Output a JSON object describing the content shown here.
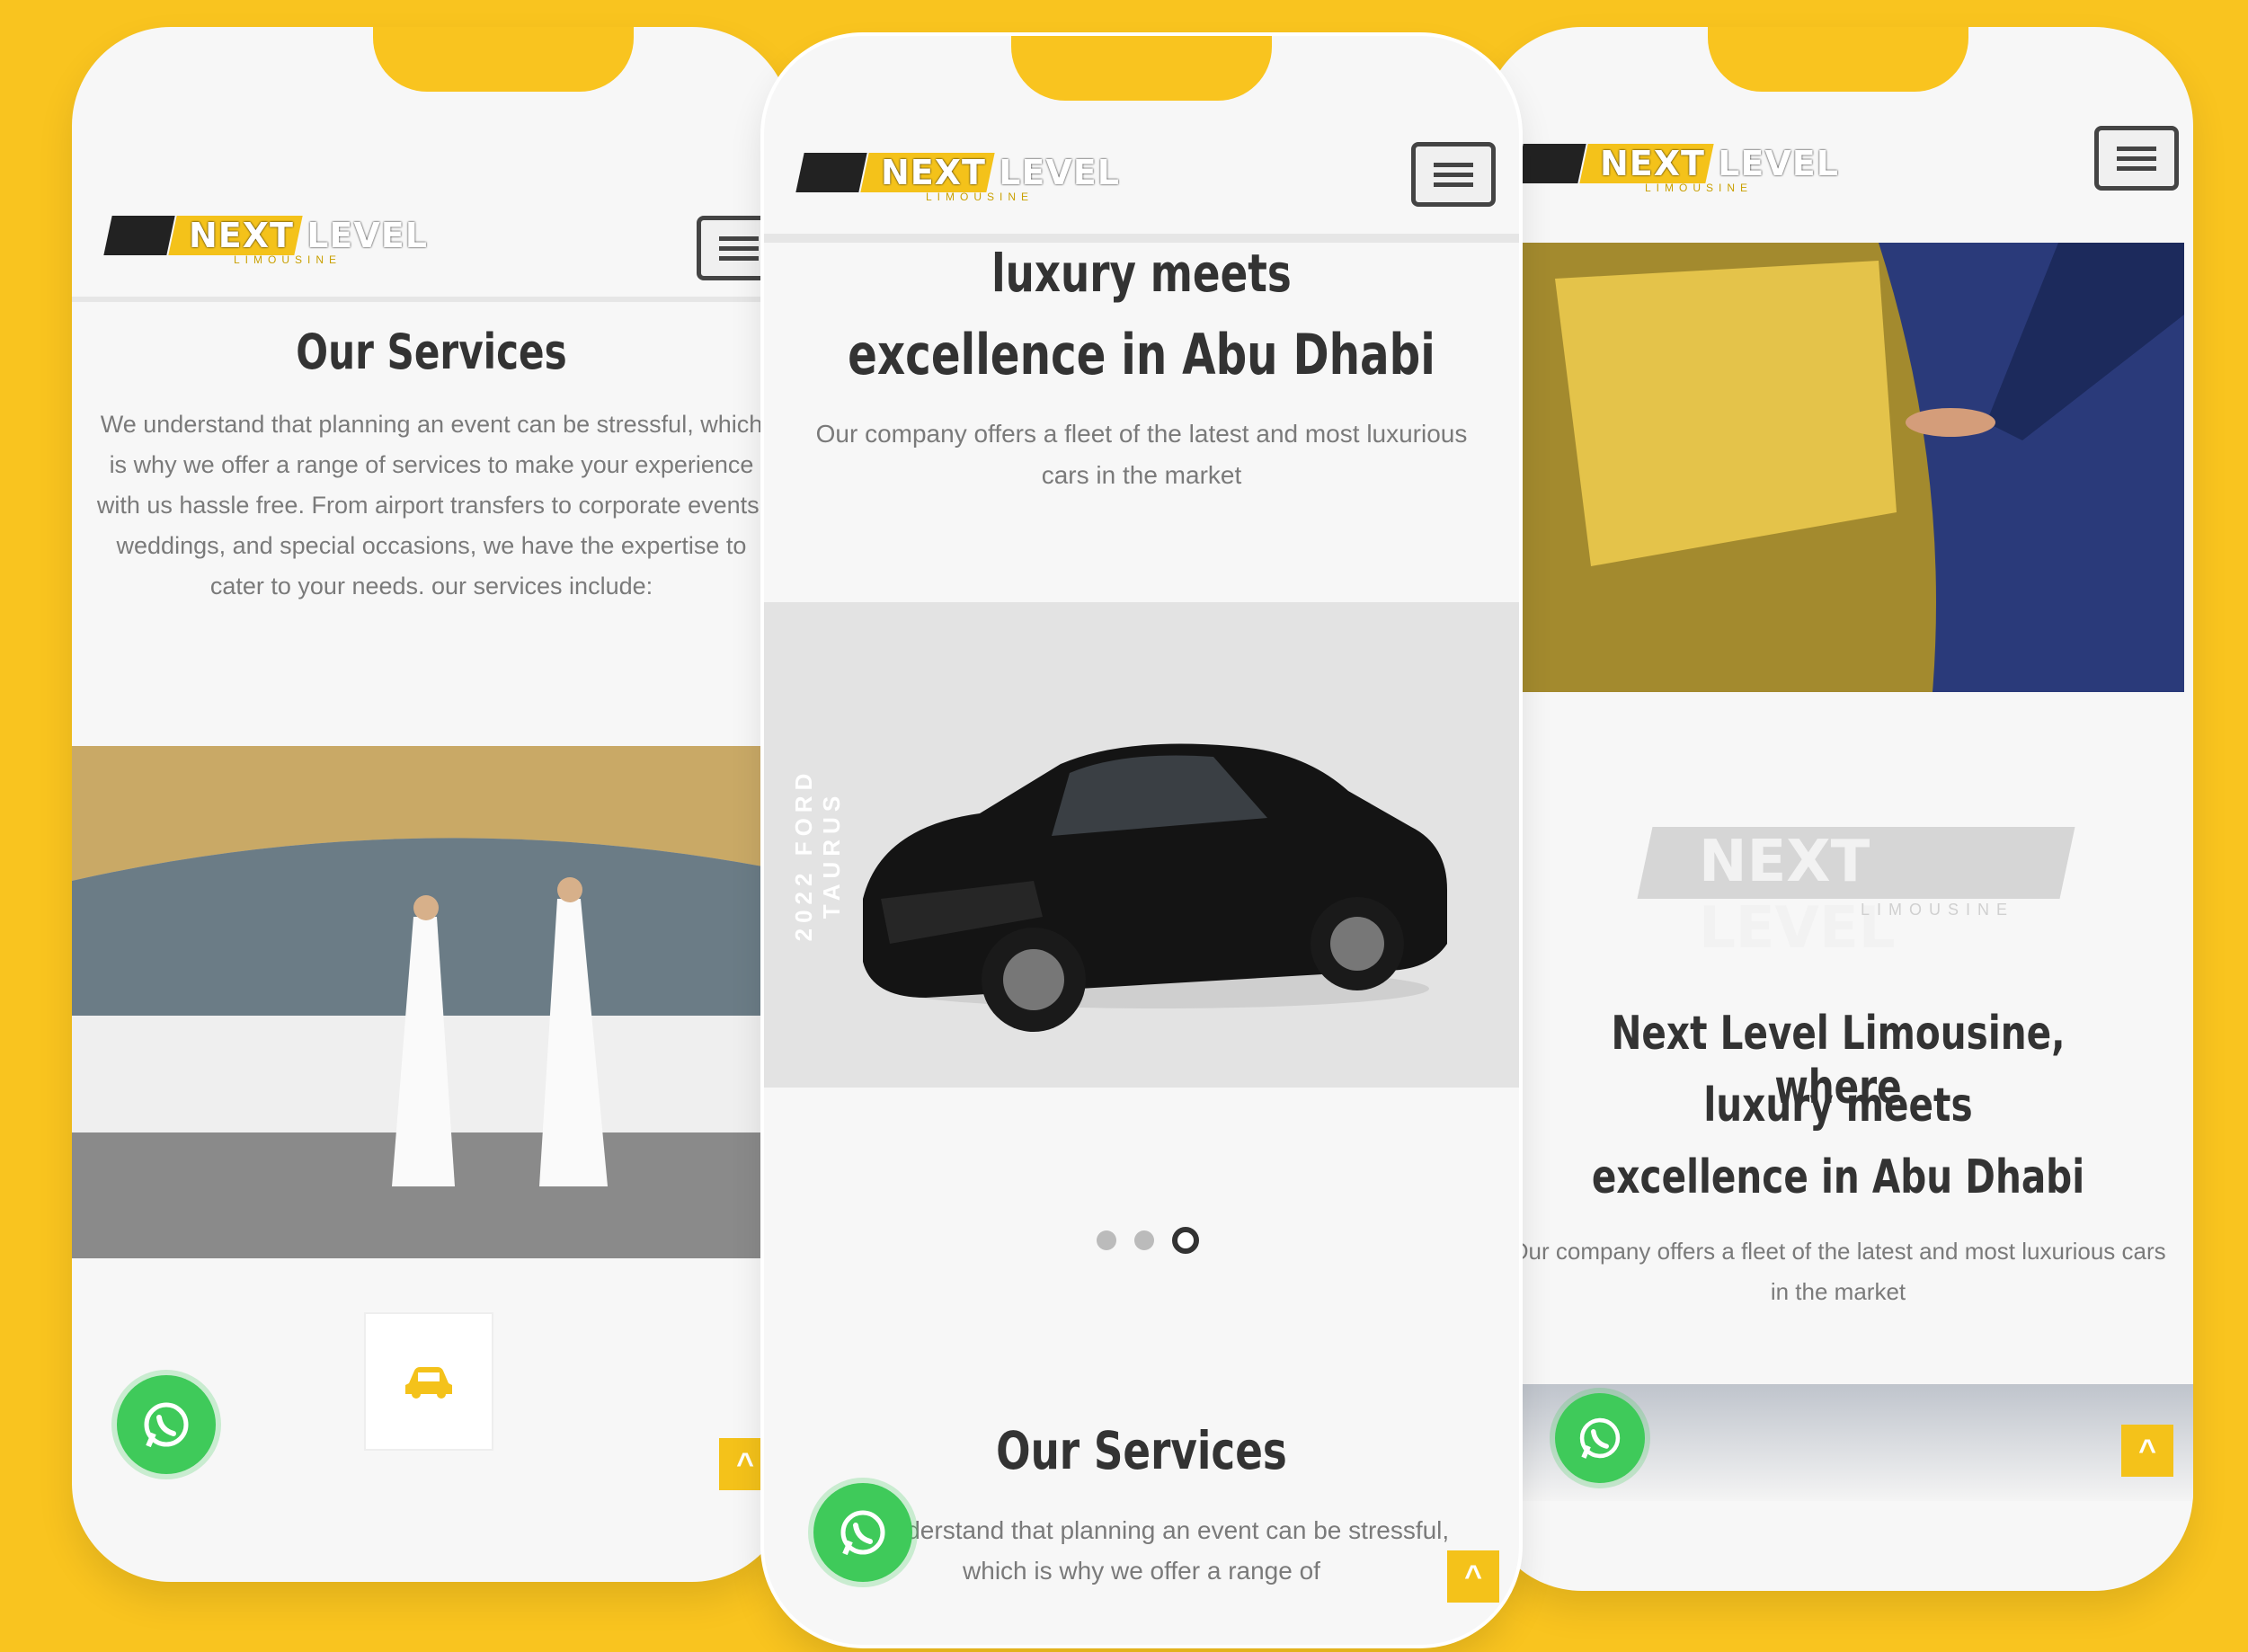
{
  "brand": {
    "logo_text": "NEXT LEVEL",
    "logo_sub": "LIMOUSINE",
    "accent": "#F9C41F",
    "whatsapp_color": "#3fca5a"
  },
  "phone_left": {
    "services_title": "Our Services",
    "services_text": "We understand that planning an event can be stressful, which is why we offer a range of services to make your experience with us hassle free. From airport transfers to corporate events, weddings, and special occasions, we have the expertise to cater to your needs. our services include:",
    "menu_icon": "hamburger-icon",
    "service_icon": "car-icon"
  },
  "phone_center": {
    "hero_title_line1": "luxury meets",
    "hero_title_line2": "excellence in Abu Dhabi",
    "hero_text": "Our company offers a fleet of the latest and most luxurious cars in the market",
    "slider_vertical_text": "2022 FORD TAURUS",
    "slider_index": 3,
    "slider_total": 3,
    "services_title": "Our Services",
    "services_text": "We understand that planning an event can be stressful, which is why we offer a range of"
  },
  "phone_right": {
    "watermark_logo": "NEXT LEVEL",
    "watermark_sub": "LIMOUSINE",
    "title_line1": "Next Level Limousine, where",
    "title_line2": "luxury meets",
    "title_line3": "excellence in Abu Dhabi",
    "text": "Our company offers a fleet of the latest and most luxurious cars in the market"
  }
}
